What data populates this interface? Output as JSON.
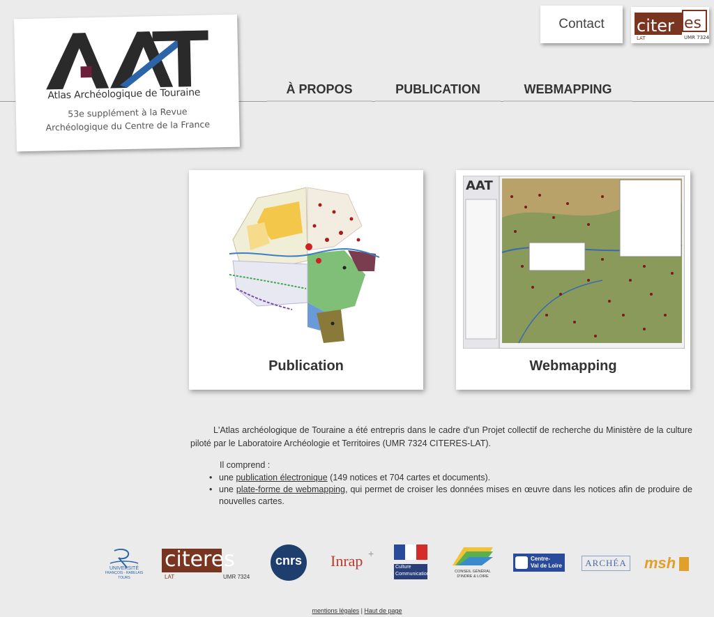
{
  "logo": {
    "letters": "AAT",
    "title": "Atlas Archéologique de Touraine",
    "subtitle_line1": "53e supplément à la Revue",
    "subtitle_line2": "Archéologique du Centre de la France"
  },
  "header": {
    "contact_label": "Contact",
    "citeres_logo_text": "citeres",
    "citeres_logo_sub": "LAT",
    "citeres_logo_umr": "UMR 7324"
  },
  "nav": {
    "items": [
      "À PROPOS",
      "PUBLICATION",
      "WEBMAPPING"
    ]
  },
  "cards": {
    "publication_label": "Publication",
    "webmapping_label": "Webmapping",
    "webmapping_brand": "AAT"
  },
  "intro": {
    "paragraph": "L'Atlas archéologique de Touraine a été entrepris dans le cadre d'un Projet collectif de recherche du Ministère de la culture piloté par le Laboratoire Archéologie et Territoires (UMR 7324 CITERES-LAT).",
    "comprend": "Il comprend :",
    "bullet1_prefix": "une ",
    "bullet1_link": "publication électronique",
    "bullet1_suffix": " (149 notices et 704 cartes et documents).",
    "bullet2_prefix": "une ",
    "bullet2_link": "plate-forme de webmapping",
    "bullet2_suffix": ", qui permet de croiser les données mises en œuvre dans les notices afin de produire de nouvelles cartes."
  },
  "partners": {
    "universite_line1": "UNIVERSITÉ",
    "universite_line2": "FRANÇOIS - RABELAIS",
    "universite_line3": "TOURS",
    "citeres": "citeres",
    "citeres_sub": "LAT",
    "citeres_umr": "UMR 7324",
    "cnrs": "cnrs",
    "inrap": "Inrap",
    "culture_line1": "Culture",
    "culture_line2": "Communication",
    "cg_line1": "CONSEIL GÉNÉRAL",
    "cg_line2": "D'INDRE & LOIRE",
    "region_line1": "Centre-",
    "region_line2": "Val de Loire",
    "archea": "ARCHÉA",
    "mshs": "msh"
  },
  "footer": {
    "mentions": "mentions légales",
    "separator": " | ",
    "haut": "Haut de page"
  },
  "colors": {
    "background": "#ebebeb",
    "aat_dark": "#2a2a2a",
    "aat_accent": "#6b1f3a",
    "aat_blue": "#2c64a8",
    "citeres_brown": "#7a3520",
    "link": "#333333"
  }
}
